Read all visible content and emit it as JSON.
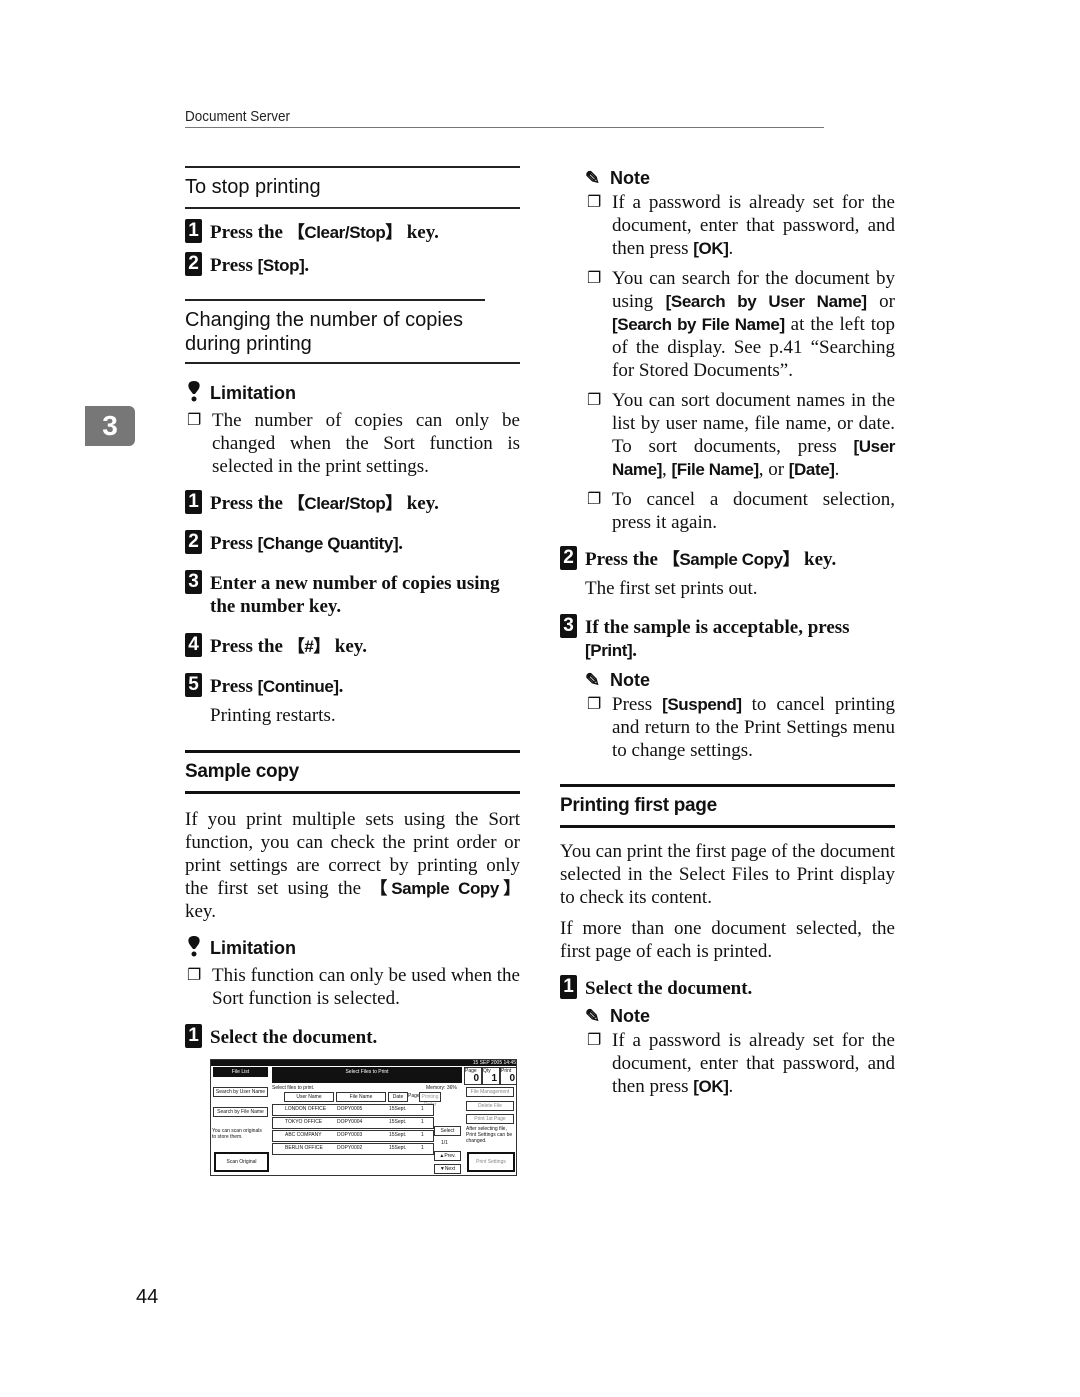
{
  "header": {
    "title": "Document Server"
  },
  "chapter_tab": "3",
  "page_number": "44",
  "left": {
    "stop_printing": {
      "heading": "To stop printing",
      "steps": [
        {
          "num": "1",
          "pre": "Press the ",
          "key": "【Clear/Stop】",
          "post": " key."
        },
        {
          "num": "2",
          "pre": "Press ",
          "key": "[Stop]",
          "post": "."
        }
      ]
    },
    "change_copies": {
      "heading": "Changing the number of copies during printing",
      "limitation_title": "Limitation",
      "limitation_text": "The number of copies can only be changed when the Sort function is selected in the print settings.",
      "steps": [
        {
          "num": "1",
          "pre": "Press the ",
          "key": "【Clear/Stop】",
          "post": " key."
        },
        {
          "num": "2",
          "pre": "Press ",
          "key": "[Change Quantity]",
          "post": "."
        },
        {
          "num": "3",
          "pre": "Enter a new number of copies using the number key.",
          "key": "",
          "post": ""
        },
        {
          "num": "4",
          "pre": "Press the ",
          "key": "【#】",
          "post": " key."
        },
        {
          "num": "5",
          "pre": "Press ",
          "key": "[Continue]",
          "post": "."
        }
      ],
      "result": "Printing restarts."
    },
    "sample_copy": {
      "heading": "Sample copy",
      "intro_pre": "If you print multiple sets using the Sort function, you can check the print order or print settings are correct by printing only the first set using the ",
      "intro_key": "【Sample Copy】",
      "intro_post": " key.",
      "limitation_title": "Limitation",
      "limitation_text": "This function can only be used when the Sort function is selected.",
      "step1": {
        "num": "1",
        "text": "Select the document."
      }
    }
  },
  "screen": {
    "file_list": "File List",
    "title": "Select Files to Print",
    "status": "15 SEP  2005 14:45",
    "counters": [
      {
        "label": "Page",
        "value": "0"
      },
      {
        "label": "Qty",
        "value": "1"
      },
      {
        "label": "Print",
        "value": "0"
      }
    ],
    "search_user": "Search by User Name",
    "search_file": "Search by File Name",
    "hint": "You can scan originals to store them.",
    "scan_original": "Scan Original",
    "select_prompt": "Select files to print.",
    "memory": "Memory: 36%",
    "columns": [
      "User Name",
      "File Name",
      "Date",
      "Page",
      "Printing Order"
    ],
    "rows": [
      {
        "user": "LONDON OFFICE",
        "file": "DOPY0005",
        "date": "15Sept.",
        "page": "1"
      },
      {
        "user": "TOKYO OFFICE",
        "file": "DOPY0004",
        "date": "15Sept.",
        "page": "1"
      },
      {
        "user": "ABC COMPANY",
        "file": "DOPY0003",
        "date": "15Sept.",
        "page": "1"
      },
      {
        "user": "BERLIN OFFICE",
        "file": "DOPY0002",
        "date": "15Sept.",
        "page": "1"
      }
    ],
    "select_btn": "Select",
    "page_indicator": "1/1",
    "prev": "▲Prev.",
    "next": "▼Next",
    "file_mgmt": "File Management",
    "delete_file": "Delete File",
    "print_first": "Print 1st Page",
    "after_select": "After selecting file, Print Settings can be changed.",
    "print_settings": "Print Settings"
  },
  "right": {
    "note1_title": "Note",
    "note1_items": [
      {
        "pre": "If a password is already set for the document, enter that password, and then press ",
        "key": "[OK]",
        "post": "."
      },
      {
        "pre": "You can search for the document by using ",
        "key": "[Search by User Name]",
        "mid": " or ",
        "key2": "[Search by File Name]",
        "post": " at the left top of the display. See p.41 “Searching for Stored Documents”."
      },
      {
        "pre": "You can sort document names in the list by user name, file name, or date. To sort documents, press ",
        "key": "[User Name]",
        "mid": ", ",
        "key2": "[File Name]",
        "mid2": ", or ",
        "key3": "[Date]",
        "post": "."
      },
      {
        "pre": "To cancel a document selection, press it again."
      }
    ],
    "step2": {
      "num": "2",
      "pre": "Press the ",
      "key": "【Sample Copy】",
      "post": " key."
    },
    "step2_result": "The first set prints out.",
    "step3": {
      "num": "3",
      "pre": "If the sample is acceptable, press ",
      "key": "[Print]",
      "post": "."
    },
    "note2_title": "Note",
    "note2_item": {
      "pre": "Press ",
      "key": "[Suspend]",
      "post": " to cancel printing and return to the Print Settings menu to change settings."
    },
    "first_page": {
      "heading": "Printing first page",
      "para1": "You can print the first page of the document selected in the Select Files to Print display to check its content.",
      "para2": "If more than one document selected, the first page of each is printed.",
      "step1": {
        "num": "1",
        "text": "Select the document."
      },
      "note_title": "Note",
      "note_item": {
        "pre": "If a password is already set for the document, enter that password, and then press ",
        "key": "[OK]",
        "post": "."
      }
    }
  }
}
